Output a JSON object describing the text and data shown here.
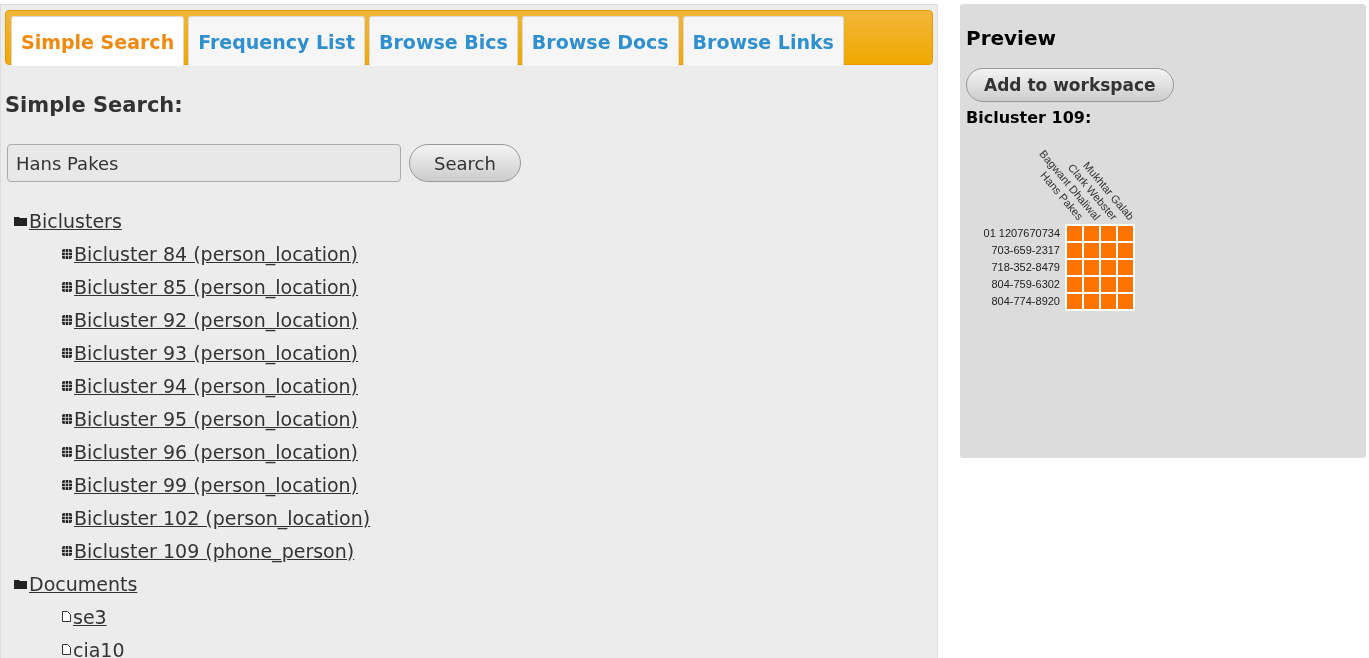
{
  "tabs": [
    {
      "label": "Simple Search",
      "selected": true
    },
    {
      "label": "Frequency List",
      "selected": false
    },
    {
      "label": "Browse Bics",
      "selected": false
    },
    {
      "label": "Browse Docs",
      "selected": false
    },
    {
      "label": "Browse Links",
      "selected": false
    }
  ],
  "search": {
    "heading": "Simple Search:",
    "value": "Hans Pakes",
    "button": "Search"
  },
  "tree": [
    {
      "kind": "folder",
      "label": "Biclusters",
      "children": [
        {
          "kind": "bicluster",
          "label": "Bicluster 84 (person_location)"
        },
        {
          "kind": "bicluster",
          "label": "Bicluster 85 (person_location)"
        },
        {
          "kind": "bicluster",
          "label": "Bicluster 92 (person_location)"
        },
        {
          "kind": "bicluster",
          "label": "Bicluster 93 (person_location)"
        },
        {
          "kind": "bicluster",
          "label": "Bicluster 94 (person_location)"
        },
        {
          "kind": "bicluster",
          "label": "Bicluster 95 (person_location)"
        },
        {
          "kind": "bicluster",
          "label": "Bicluster 96 (person_location)"
        },
        {
          "kind": "bicluster",
          "label": "Bicluster 99 (person_location)"
        },
        {
          "kind": "bicluster",
          "label": "Bicluster 102 (person_location)"
        },
        {
          "kind": "bicluster",
          "label": "Bicluster 109 (phone_person)"
        }
      ]
    },
    {
      "kind": "folder",
      "label": "Documents",
      "children": [
        {
          "kind": "document",
          "label": "se3"
        },
        {
          "kind": "document",
          "label": "cia10"
        }
      ]
    }
  ],
  "preview": {
    "title": "Preview",
    "button": "Add to workspace",
    "subtitle": "Bicluster 109:",
    "matrix": {
      "columns": [
        "Hans Pakes",
        "Bagwant Dhaliwal",
        "Clark Webster",
        "Mukhtar Galab"
      ],
      "rows": [
        {
          "label": "01 1207670734",
          "cells": [
            true,
            true,
            true,
            true
          ]
        },
        {
          "label": "703-659-2317",
          "cells": [
            true,
            true,
            true,
            true
          ]
        },
        {
          "label": "718-352-8479",
          "cells": [
            true,
            true,
            true,
            true
          ]
        },
        {
          "label": "804-759-6302",
          "cells": [
            true,
            true,
            true,
            true
          ]
        },
        {
          "label": "804-774-8920",
          "cells": [
            true,
            true,
            true,
            true
          ]
        }
      ]
    }
  }
}
